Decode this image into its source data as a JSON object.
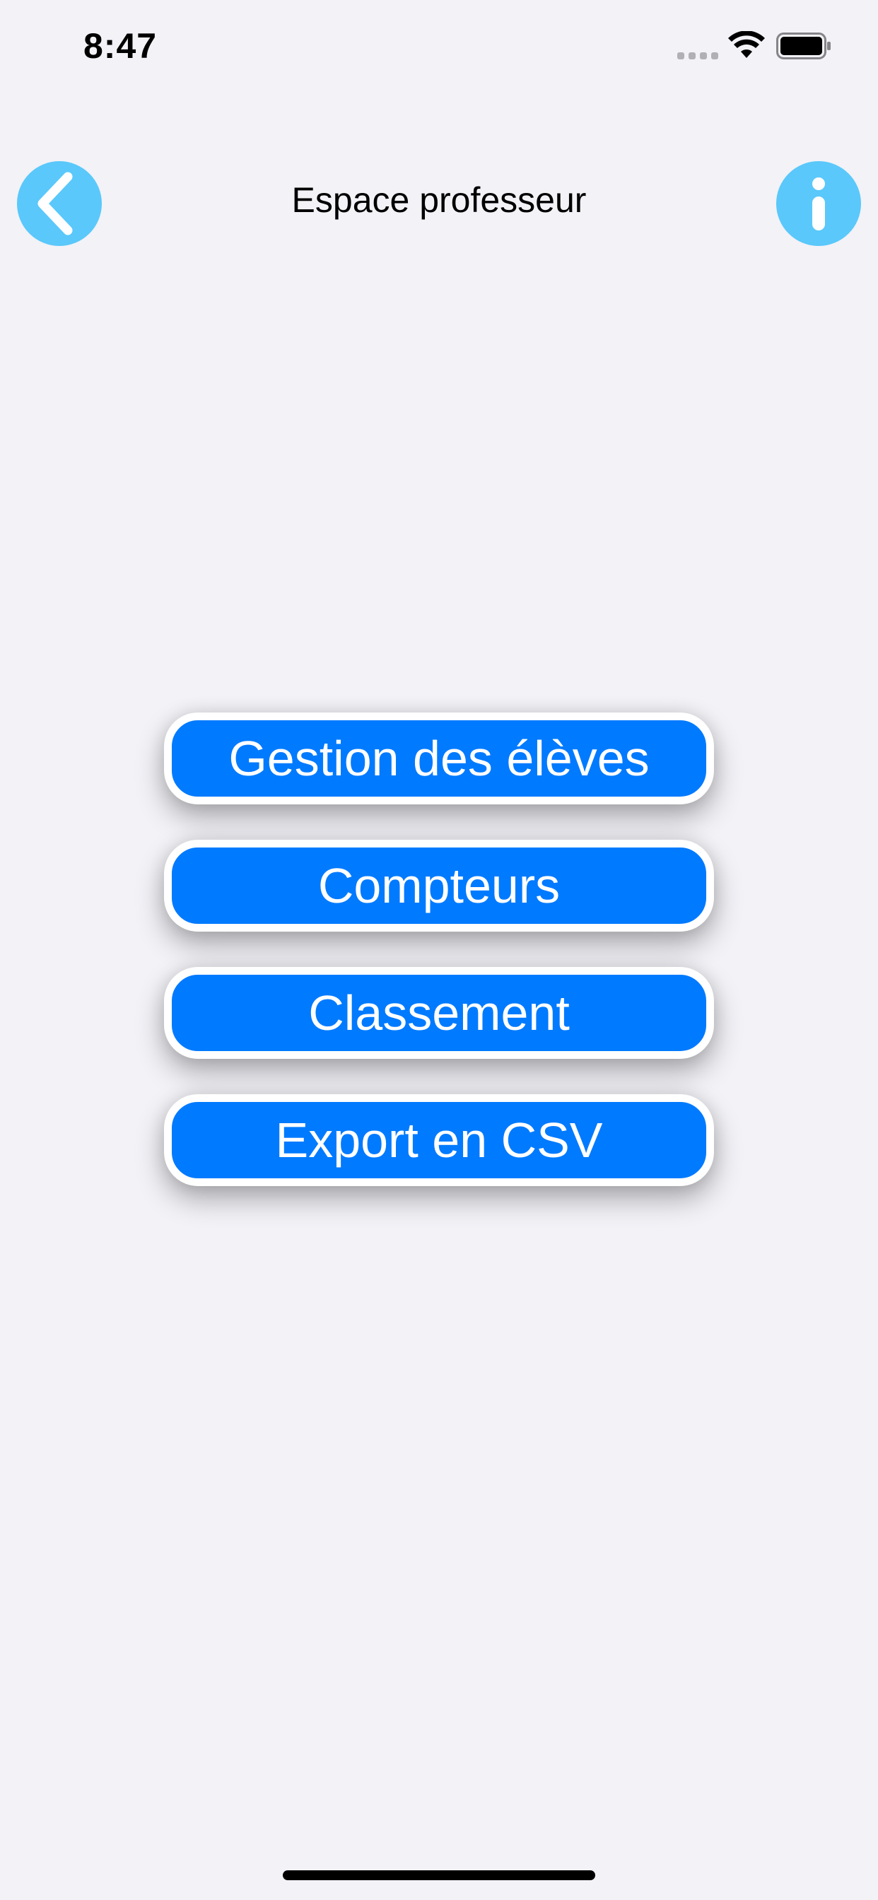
{
  "status_bar": {
    "time": "8:47",
    "icons": [
      "cellular-signal-icon",
      "wifi-icon",
      "battery-icon"
    ]
  },
  "nav": {
    "title": "Espace professeur",
    "back_icon": "chevron-left-icon",
    "info_icon": "info-icon"
  },
  "menu": {
    "items": [
      {
        "label": "Gestion des élèves"
      },
      {
        "label": "Compteurs"
      },
      {
        "label": "Classement"
      },
      {
        "label": "Export en CSV"
      }
    ]
  },
  "colors": {
    "background": "#f2f2f7",
    "accent_round_button": "#5ac8fa",
    "menu_button": "#007aff",
    "menu_button_border": "#ffffff",
    "text_on_button": "#ffffff"
  }
}
